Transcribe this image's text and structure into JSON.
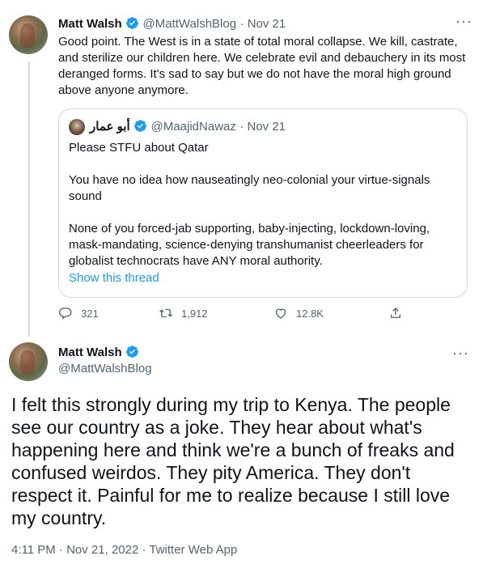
{
  "tweet1": {
    "name": "Matt Walsh",
    "handle": "@MattWalshBlog",
    "date": "Nov 21",
    "text": "Good point. The West is in a state of total moral collapse. We kill, castrate, and sterilize our children here. We celebrate evil and debauchery in its most deranged forms. It's sad to say but we do not have the moral high ground above anyone anymore.",
    "more_icon": "more-dots-icon"
  },
  "quote": {
    "name": "أبو عمار",
    "handle": "@MaajidNawaz",
    "date": "Nov 21",
    "paragraphs": [
      "Please STFU about Qatar",
      "You have no idea how nauseatingly neo-colonial your virtue-signals sound",
      "None of you forced-jab supporting, baby-injecting, lockdown-loving, mask-mandating, science-denying transhumanist cheerleaders for globalist technocrats have ANY moral authority."
    ],
    "show_thread": "Show this thread"
  },
  "actions": {
    "replies": "321",
    "retweets": "1,912",
    "likes": "12.8K"
  },
  "tweet2": {
    "name": "Matt Walsh",
    "handle": "@MattWalshBlog",
    "text": "I felt this strongly during my trip to Kenya. The people see our country as a joke. They hear about what's happening here and think we're a bunch of freaks and confused weirdos. They pity America. They don't respect it. Painful for me to realize because I still love my country.",
    "meta": "4:11 PM · Nov 21, 2022 · Twitter Web App"
  },
  "colors": {
    "accent": "#1d9bf0",
    "muted": "#536471",
    "text": "#0f1419",
    "border": "#cfd9de"
  }
}
